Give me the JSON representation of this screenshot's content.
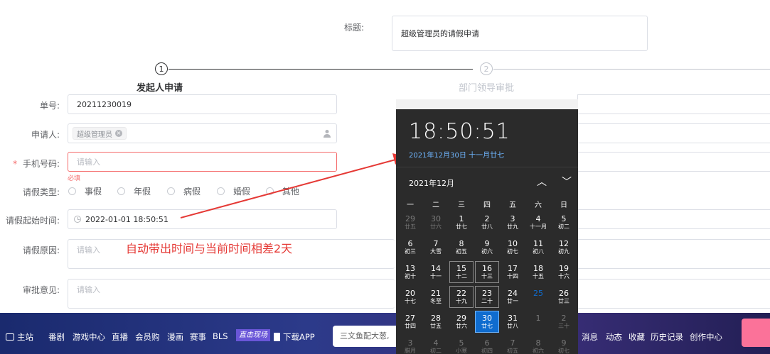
{
  "form": {
    "title_label": "标题:",
    "title_value": "超级管理员的请假申请",
    "steps": [
      {
        "num": "1",
        "label": "发起人申请"
      },
      {
        "num": "2",
        "label": "部门领导审批"
      }
    ],
    "fields": {
      "order_label": "单号:",
      "order_value": "20211230019",
      "applicant_label": "申请人:",
      "applicant_tag": "超级管理员",
      "phone_star": "*",
      "phone_label": "手机号码:",
      "phone_placeholder": "请输入",
      "phone_error": "必填",
      "leave_type_label": "请假类型:",
      "leave_types": [
        "事假",
        "年假",
        "病假",
        "婚假",
        "其他"
      ],
      "start_label": "请假起始时间:",
      "start_value": "2022-01-01 18:50:51",
      "reason_label": "请假原因:",
      "reason_placeholder": "请输入",
      "opinion_label": "审批意见:",
      "opinion_placeholder": "请输入"
    }
  },
  "annotation": {
    "text": "自动带出时间与当前时间相差2天",
    "color": "#e53935"
  },
  "calendar": {
    "time": "18:50:51",
    "date_line": "2021年12月30日 十一月廿七",
    "month_label": "2021年12月",
    "weekdays": [
      "一",
      "二",
      "三",
      "四",
      "五",
      "六",
      "日"
    ],
    "rows": [
      [
        [
          "29",
          "廿五",
          "dim"
        ],
        [
          "30",
          "廿六",
          "dim"
        ],
        [
          "1",
          "廿七",
          ""
        ],
        [
          "2",
          "廿八",
          ""
        ],
        [
          "3",
          "廿九",
          ""
        ],
        [
          "4",
          "十一月",
          ""
        ],
        [
          "5",
          "初二",
          ""
        ]
      ],
      [
        [
          "6",
          "初三",
          ""
        ],
        [
          "7",
          "大雪",
          ""
        ],
        [
          "8",
          "初五",
          ""
        ],
        [
          "9",
          "初六",
          ""
        ],
        [
          "10",
          "初七",
          ""
        ],
        [
          "11",
          "初八",
          ""
        ],
        [
          "12",
          "初九",
          ""
        ]
      ],
      [
        [
          "13",
          "初十",
          ""
        ],
        [
          "14",
          "十一",
          ""
        ],
        [
          "15",
          "十二",
          "box"
        ],
        [
          "16",
          "十三",
          "box"
        ],
        [
          "17",
          "十四",
          ""
        ],
        [
          "18",
          "十五",
          ""
        ],
        [
          "19",
          "十六",
          ""
        ]
      ],
      [
        [
          "20",
          "十七",
          ""
        ],
        [
          "21",
          "冬至",
          ""
        ],
        [
          "22",
          "十九",
          "box"
        ],
        [
          "23",
          "二十",
          "box"
        ],
        [
          "24",
          "廿一",
          ""
        ],
        [
          "25",
          "",
          "today"
        ],
        [
          "26",
          "廿三",
          ""
        ]
      ],
      [
        [
          "27",
          "廿四",
          ""
        ],
        [
          "28",
          "廿五",
          ""
        ],
        [
          "29",
          "廿六",
          ""
        ],
        [
          "30",
          "廿七",
          "sel"
        ],
        [
          "31",
          "廿八",
          ""
        ],
        [
          "1",
          "",
          "dim"
        ],
        [
          "2",
          "三十",
          "dim"
        ]
      ],
      [
        [
          "3",
          "腊月",
          "dim"
        ],
        [
          "4",
          "初二",
          "dim"
        ],
        [
          "5",
          "小寒",
          "dim"
        ],
        [
          "6",
          "初四",
          "dim"
        ],
        [
          "7",
          "初五",
          "dim"
        ],
        [
          "8",
          "初六",
          "dim"
        ],
        [
          "9",
          "初七",
          "dim"
        ]
      ]
    ]
  },
  "bottom_nav": {
    "left_items": [
      "主站",
      "番剧",
      "游戏中心",
      "直播",
      "会员购",
      "漫画",
      "赛事",
      "BLS"
    ],
    "badge": "直击现场",
    "download": "下载APP",
    "search_placeholder": "三文鱼配大葱,",
    "right_items": [
      "消息",
      "动态",
      "收藏",
      "历史记录",
      "创作中心"
    ]
  }
}
